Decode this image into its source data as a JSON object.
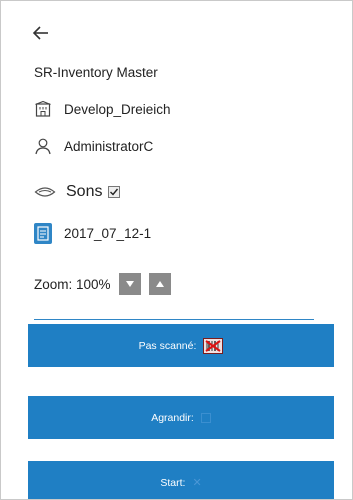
{
  "header": {
    "back_icon": "arrow-left-icon"
  },
  "app_title": "SR-Inventory Master",
  "location": {
    "icon": "building-icon",
    "label": "Develop_Dreieich"
  },
  "user": {
    "icon": "user-icon",
    "label": "AdministratorC"
  },
  "sons": {
    "icon": "eye-icon",
    "label": "Sons",
    "checked": true
  },
  "document": {
    "icon": "document-icon",
    "label": "2017_07_12-1"
  },
  "zoom": {
    "label": "Zoom: 100%",
    "down_icon": "triangle-down-icon",
    "up_icon": "triangle-up-icon"
  },
  "buttons": {
    "not_scanned": {
      "label": "Pas scanné:",
      "icon": "barcode-x-icon"
    },
    "enlarge": {
      "label": "Agrandir:",
      "icon": "checkbox-icon"
    },
    "start": {
      "label": "Start:",
      "icon": "x-icon"
    }
  },
  "colors": {
    "accent": "#1f7fc4",
    "zoom_button": "#8a8a8a"
  }
}
